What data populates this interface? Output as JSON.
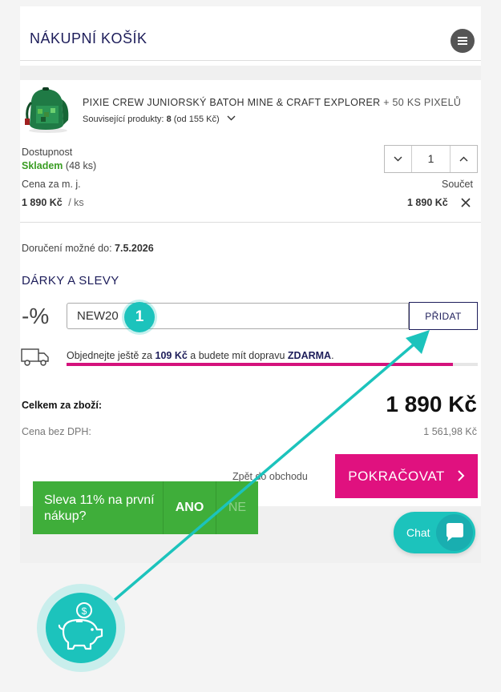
{
  "header": {
    "title": "NÁKUPNÍ KOŠÍK",
    "menu_icon": "hamburger-menu-icon"
  },
  "cart_item": {
    "name": "PIXIE CREW JUNIORSKÝ BATOH MINE & CRAFT EXPLORER",
    "name_suffix": "+ 50 KS PIXELŮ",
    "related_label": "Související produkty:",
    "related_count": "8",
    "related_from": "(od 155 Kč)",
    "availability_label": "Dostupnost",
    "stock_status": "Skladem",
    "stock_count": "(48 ks)",
    "unit_price_label": "Cena za m. j.",
    "unit_price": "1 890 Kč",
    "unit_suffix": "/ ks",
    "sum_label": "Součet",
    "sum_value": "1 890 Kč",
    "quantity": "1"
  },
  "delivery": {
    "label": "Doručení možné do:",
    "date": "7.5.2026"
  },
  "gifts": {
    "title": "DÁRKY A SLEVY",
    "percent_symbol": "-%",
    "code_value": "NEW20",
    "add_label": "PŘIDAT",
    "step_number": "1"
  },
  "shipping": {
    "text_before": "Objednejte ještě za",
    "amount": "109 Kč",
    "text_middle": "a budete mít dopravu",
    "free_label": "ZDARMA",
    "progress": 0.94
  },
  "totals": {
    "goods_label": "Celkem za zboží:",
    "goods_value": "1 890 Kč",
    "net_label": "Cena bez DPH:",
    "net_value": "1 561,98 Kč"
  },
  "actions": {
    "back_label": "Zpět do obchodu",
    "continue_label": "POKRAČOVAT"
  },
  "promo": {
    "text": "Sleva 11% na první nákup?",
    "yes_label": "ANO",
    "no_label": "NE"
  },
  "chat": {
    "label": "Chat"
  },
  "colors": {
    "accent": "#e0117f",
    "navy": "#1d1d5a",
    "teal": "#1cc3bc",
    "green": "#3fae3a",
    "stock_green": "#3a9d23"
  }
}
